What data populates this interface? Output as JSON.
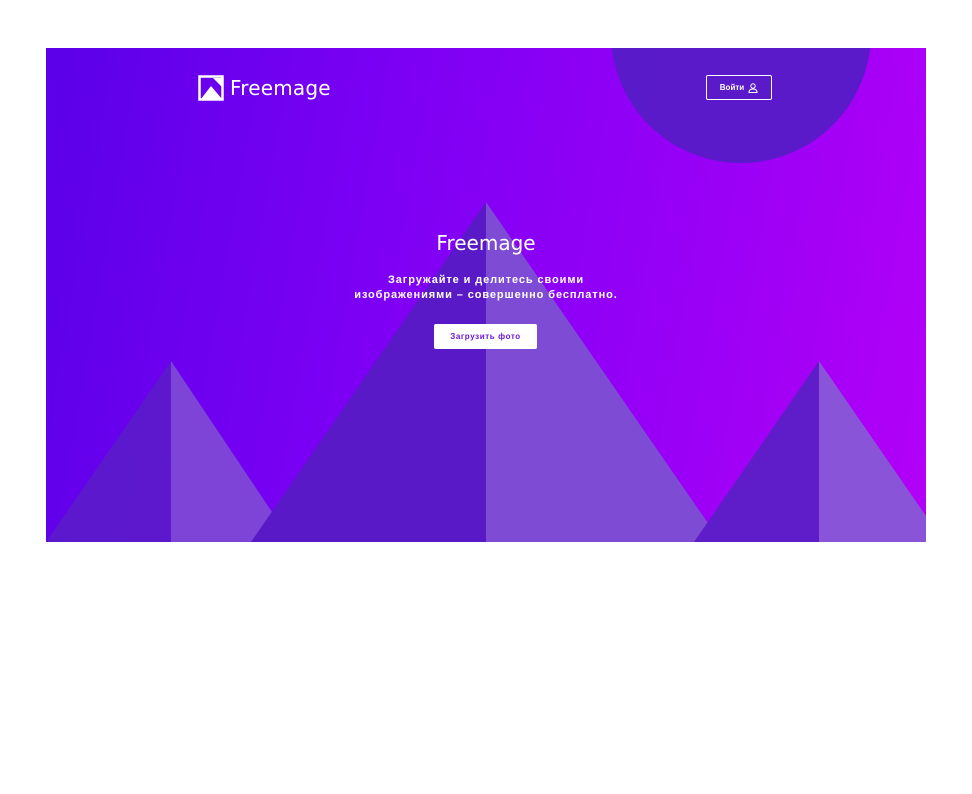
{
  "header": {
    "brand": "Freemage",
    "login_label": "Войти",
    "logo_icon": "image-logo-icon",
    "user_icon": "user-icon"
  },
  "hero": {
    "title": "Freemage",
    "subtitle_line1": "Загружайте и делитесь своими",
    "subtitle_line2": "изображениями – совершенно бесплатно.",
    "upload_label": "Загрузить фото"
  },
  "colors": {
    "gradient_start": "#5a00e8",
    "gradient_end": "#b300f7",
    "accent_text": "#6a14d8",
    "circle": "#561bc6"
  }
}
